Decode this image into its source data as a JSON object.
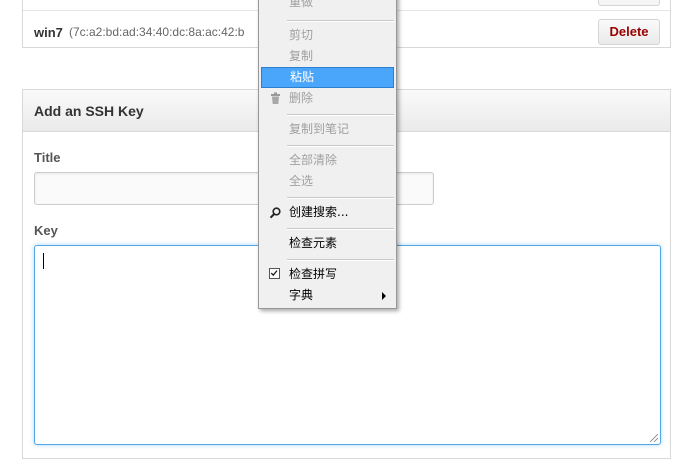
{
  "keys_list": {
    "rows": [
      {
        "name": "win7",
        "fingerprint": "(7c:a2:bd:ad:34:40:dc:8a:ac:42:b",
        "delete_label": "Delete"
      }
    ]
  },
  "add_ssh_key": {
    "title": "Add an SSH Key",
    "title_label": "Title",
    "title_value": "",
    "key_label": "Key",
    "key_value": ""
  },
  "context_menu": {
    "items": [
      {
        "label": "重做",
        "state": "disabled"
      },
      {
        "label": "剪切",
        "state": "disabled"
      },
      {
        "label": "复制",
        "state": "disabled"
      },
      {
        "label": "粘贴",
        "state": "highlighted"
      },
      {
        "label": "删除",
        "state": "disabled",
        "icon": "trash-icon"
      },
      {
        "label": "复制到笔记",
        "state": "disabled"
      },
      {
        "label": "全部清除",
        "state": "disabled"
      },
      {
        "label": "全选",
        "state": "disabled"
      },
      {
        "label": "创建搜索...",
        "state": "enabled",
        "icon": "search-icon"
      },
      {
        "label": "检查元素",
        "state": "enabled"
      },
      {
        "label": "检查拼写",
        "state": "checked"
      },
      {
        "label": "字典",
        "state": "submenu"
      }
    ]
  },
  "colors": {
    "delete_text": "#990000",
    "menu_highlight": "#4aa6fb",
    "focus_border": "#51a7e8"
  }
}
